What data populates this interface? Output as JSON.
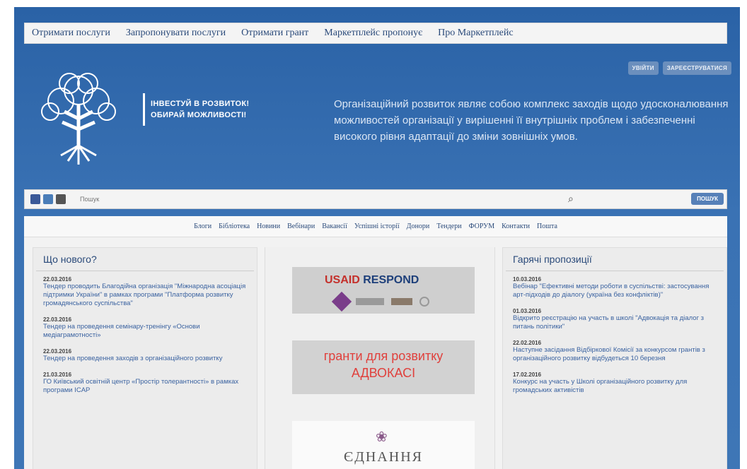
{
  "topnav": [
    "Отримати послуги",
    "Запропонувати послуги",
    "Отримати грант",
    "Маркетплейс пропонує",
    "Про Маркетплейс"
  ],
  "auth": {
    "login": "УВІЙТИ",
    "register": "ЗАРЕЄСТРУВАТИСЯ"
  },
  "slogan": {
    "line1": "ІНВЕСТУЙ В РОЗВИТОК!",
    "line2": "ОБИРАЙ МОЖЛИВОСТІ!"
  },
  "lead": "Організаційний розвиток являє собою комплекс заходів щодо удосконалювання можливостей організації у вирішенні її внутрішніх проблем і забезпеченні високого рівня адаптації до зміни зовнішніх умов.",
  "search": {
    "placeholder": "Пошук",
    "button": "ПОШУК"
  },
  "subnav": [
    "Блоги",
    "Бібліотека",
    "Новини",
    "Вебінари",
    "Вакансії",
    "Успішні історії",
    "Донори",
    "Тендери",
    "ФОРУМ",
    "Контакти",
    "Пошта"
  ],
  "news": {
    "title": "Що нового?",
    "items": [
      {
        "date": "22.03.2016",
        "text": "Тендер проводить Благодійна організація \"Міжнародна асоціація підтримки України\" в рамках програми \"Платформа розвитку громадянського суспільства\""
      },
      {
        "date": "22.03.2016",
        "text": "Тендер на проведення семінару-тренінгу «Основи медіаграмотності»"
      },
      {
        "date": "22.03.2016",
        "text": "Тендер на проведення заходів з організаційного розвитку"
      },
      {
        "date": "21.03.2016",
        "text": "ГО Київський освітній центр «Простір толерантності» в рамках програми ICAP"
      }
    ]
  },
  "offers": {
    "title": "Гарячі пропозиції",
    "items": [
      {
        "date": "10.03.2016",
        "text": "Вебінар \"Ефективні методи роботи в суспільстві: застосування арт-підходів до діалогу (україна без конфліктів)\""
      },
      {
        "date": "01.03.2016",
        "text": "Відкрито реєстрацію на участь в школі \"Адвокація та діалог з питань політики\""
      },
      {
        "date": "22.02.2016",
        "text": "Наступне засідання Відбіркової Комісії за конкурсом грантів з організаційного розвитку відбудеться 10 березня"
      },
      {
        "date": "17.02.2016",
        "text": "Конкурс на участь у Школі організаційного розвитку для громадських активістів"
      }
    ]
  },
  "banners": {
    "usaid": "USAID",
    "respond": "RESPOND",
    "grant_line1": "гранти для розвитку",
    "grant_line2": "АДВОКАСІ",
    "ednannya": "ЄДНАННЯ"
  }
}
